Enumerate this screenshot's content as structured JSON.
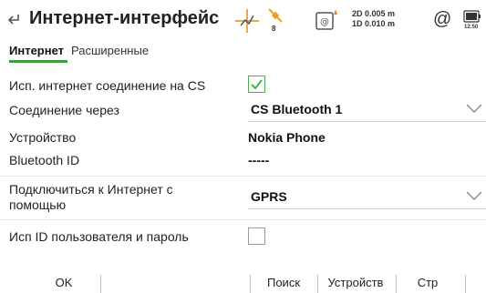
{
  "header": {
    "title": "Интернет-интерфейс",
    "satellites": "8",
    "precision_2d": "2D 0.005 m",
    "precision_1d": "1D 0.010 m",
    "time": "12:50",
    "icons": [
      "back-icon",
      "gps-icon",
      "satellite-icon",
      "device-status-icon",
      "at-icon",
      "battery-icon"
    ]
  },
  "tabs": [
    {
      "label": "Интернет",
      "active": true
    },
    {
      "label": "Расширенные",
      "active": false
    }
  ],
  "form": {
    "use_cs_label": "Исп. интернет соединение на CS",
    "use_cs_checked": true,
    "connection_label": "Соединение через",
    "connection_value": "CS Bluetooth 1",
    "device_label": "Устройство",
    "device_value": "Nokia Phone",
    "bluetooth_label": "Bluetooth ID",
    "bluetooth_value": "-----",
    "connect_label_line1": "Подключиться к Интернет с",
    "connect_label_line2": "помощью",
    "connect_value": "GPRS",
    "userid_label": "Исп  ID пользователя и пароль",
    "userid_checked": false
  },
  "buttons": {
    "ok": "OK",
    "search": "Поиск",
    "devices": "Устройств",
    "page": "Стр"
  },
  "colors": {
    "accent": "#3aa03a",
    "checkbox_checked": "#4caf50"
  }
}
